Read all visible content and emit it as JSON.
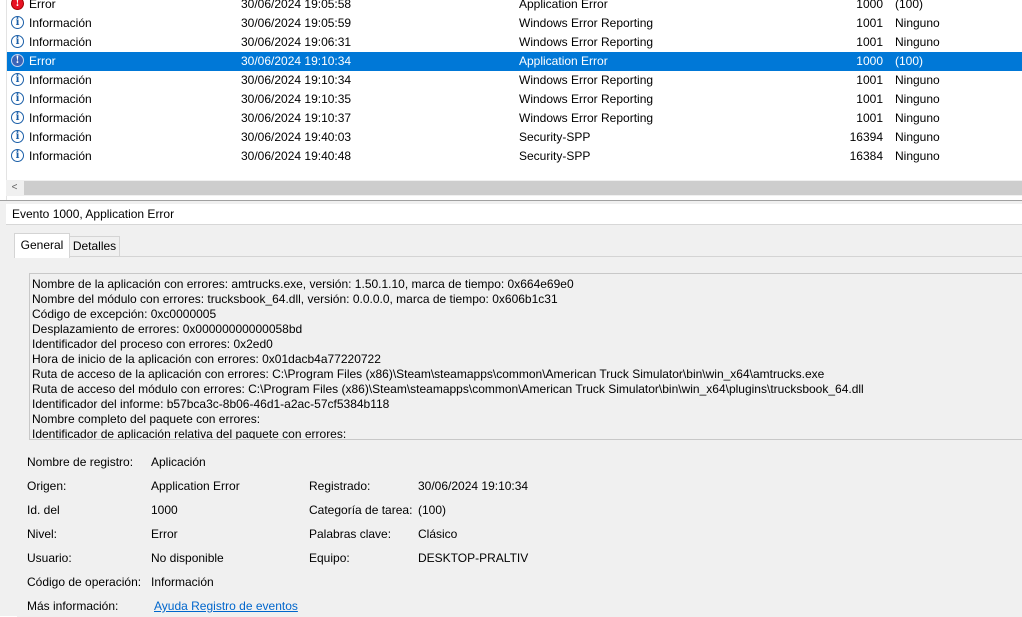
{
  "event_list": {
    "rows": [
      {
        "level": "Error",
        "icon": "error-icon",
        "date": "30/06/2024 19:05:58",
        "source": "Application Error",
        "id": "1000",
        "task": "(100)",
        "selected": false
      },
      {
        "level": "Información",
        "icon": "info-icon",
        "date": "30/06/2024 19:05:59",
        "source": "Windows Error Reporting",
        "id": "1001",
        "task": "Ninguno",
        "selected": false
      },
      {
        "level": "Información",
        "icon": "info-icon",
        "date": "30/06/2024 19:06:31",
        "source": "Windows Error Reporting",
        "id": "1001",
        "task": "Ninguno",
        "selected": false
      },
      {
        "level": "Error",
        "icon": "error-icon",
        "date": "30/06/2024 19:10:34",
        "source": "Application Error",
        "id": "1000",
        "task": "(100)",
        "selected": true
      },
      {
        "level": "Información",
        "icon": "info-icon",
        "date": "30/06/2024 19:10:34",
        "source": "Windows Error Reporting",
        "id": "1001",
        "task": "Ninguno",
        "selected": false
      },
      {
        "level": "Información",
        "icon": "info-icon",
        "date": "30/06/2024 19:10:35",
        "source": "Windows Error Reporting",
        "id": "1001",
        "task": "Ninguno",
        "selected": false
      },
      {
        "level": "Información",
        "icon": "info-icon",
        "date": "30/06/2024 19:10:37",
        "source": "Windows Error Reporting",
        "id": "1001",
        "task": "Ninguno",
        "selected": false
      },
      {
        "level": "Información",
        "icon": "info-icon",
        "date": "30/06/2024 19:40:03",
        "source": "Security-SPP",
        "id": "16394",
        "task": "Ninguno",
        "selected": false
      },
      {
        "level": "Información",
        "icon": "info-icon",
        "date": "30/06/2024 19:40:48",
        "source": "Security-SPP",
        "id": "16384",
        "task": "Ninguno",
        "selected": false
      }
    ]
  },
  "scrollbar": {
    "left_arrow": "<"
  },
  "detail": {
    "header": "Evento 1000, Application Error",
    "tabs": {
      "general": "General",
      "details": "Detalles"
    },
    "description_lines": [
      "Nombre de la aplicación con errores: amtrucks.exe, versión: 1.50.1.10, marca de tiempo: 0x664e69e0",
      "Nombre del módulo con errores: trucksbook_64.dll, versión: 0.0.0.0, marca de tiempo: 0x606b1c31",
      "Código de excepción: 0xc0000005",
      "Desplazamiento de errores: 0x00000000000058bd",
      "Identificador del proceso con errores: 0x2ed0",
      "Hora de inicio de la aplicación con errores: 0x01dacb4a77220722",
      "Ruta de acceso de la aplicación con errores: C:\\Program Files (x86)\\Steam\\steamapps\\common\\American Truck Simulator\\bin\\win_x64\\amtrucks.exe",
      "Ruta de acceso del módulo con errores: C:\\Program Files (x86)\\Steam\\steamapps\\common\\American Truck Simulator\\bin\\win_x64\\plugins\\trucksbook_64.dll",
      "Identificador del informe: b57bca3c-8b06-46d1-a2ac-57cf5384b118",
      "Nombre completo del paquete con errores:",
      "Identificador de aplicación relativa del paquete con errores:"
    ],
    "properties": {
      "log_name_label": "Nombre de registro:",
      "log_name": "Aplicación",
      "source_label": "Origen:",
      "source": "Application Error",
      "logged_label": "Registrado:",
      "logged": "30/06/2024 19:10:34",
      "event_id_label": "Id. del",
      "event_id": "1000",
      "task_label": "Categoría de tarea:",
      "task": "(100)",
      "level_label": "Nivel:",
      "level": "Error",
      "keywords_label": "Palabras clave:",
      "keywords": "Clásico",
      "user_label": "Usuario:",
      "user": "No disponible",
      "computer_label": "Equipo:",
      "computer": "DESKTOP-PRALTIV",
      "opcode_label": "Código de operación:",
      "opcode": "Información",
      "more_info_label": "Más información:",
      "more_info_link": "Ayuda Registro de eventos"
    }
  }
}
